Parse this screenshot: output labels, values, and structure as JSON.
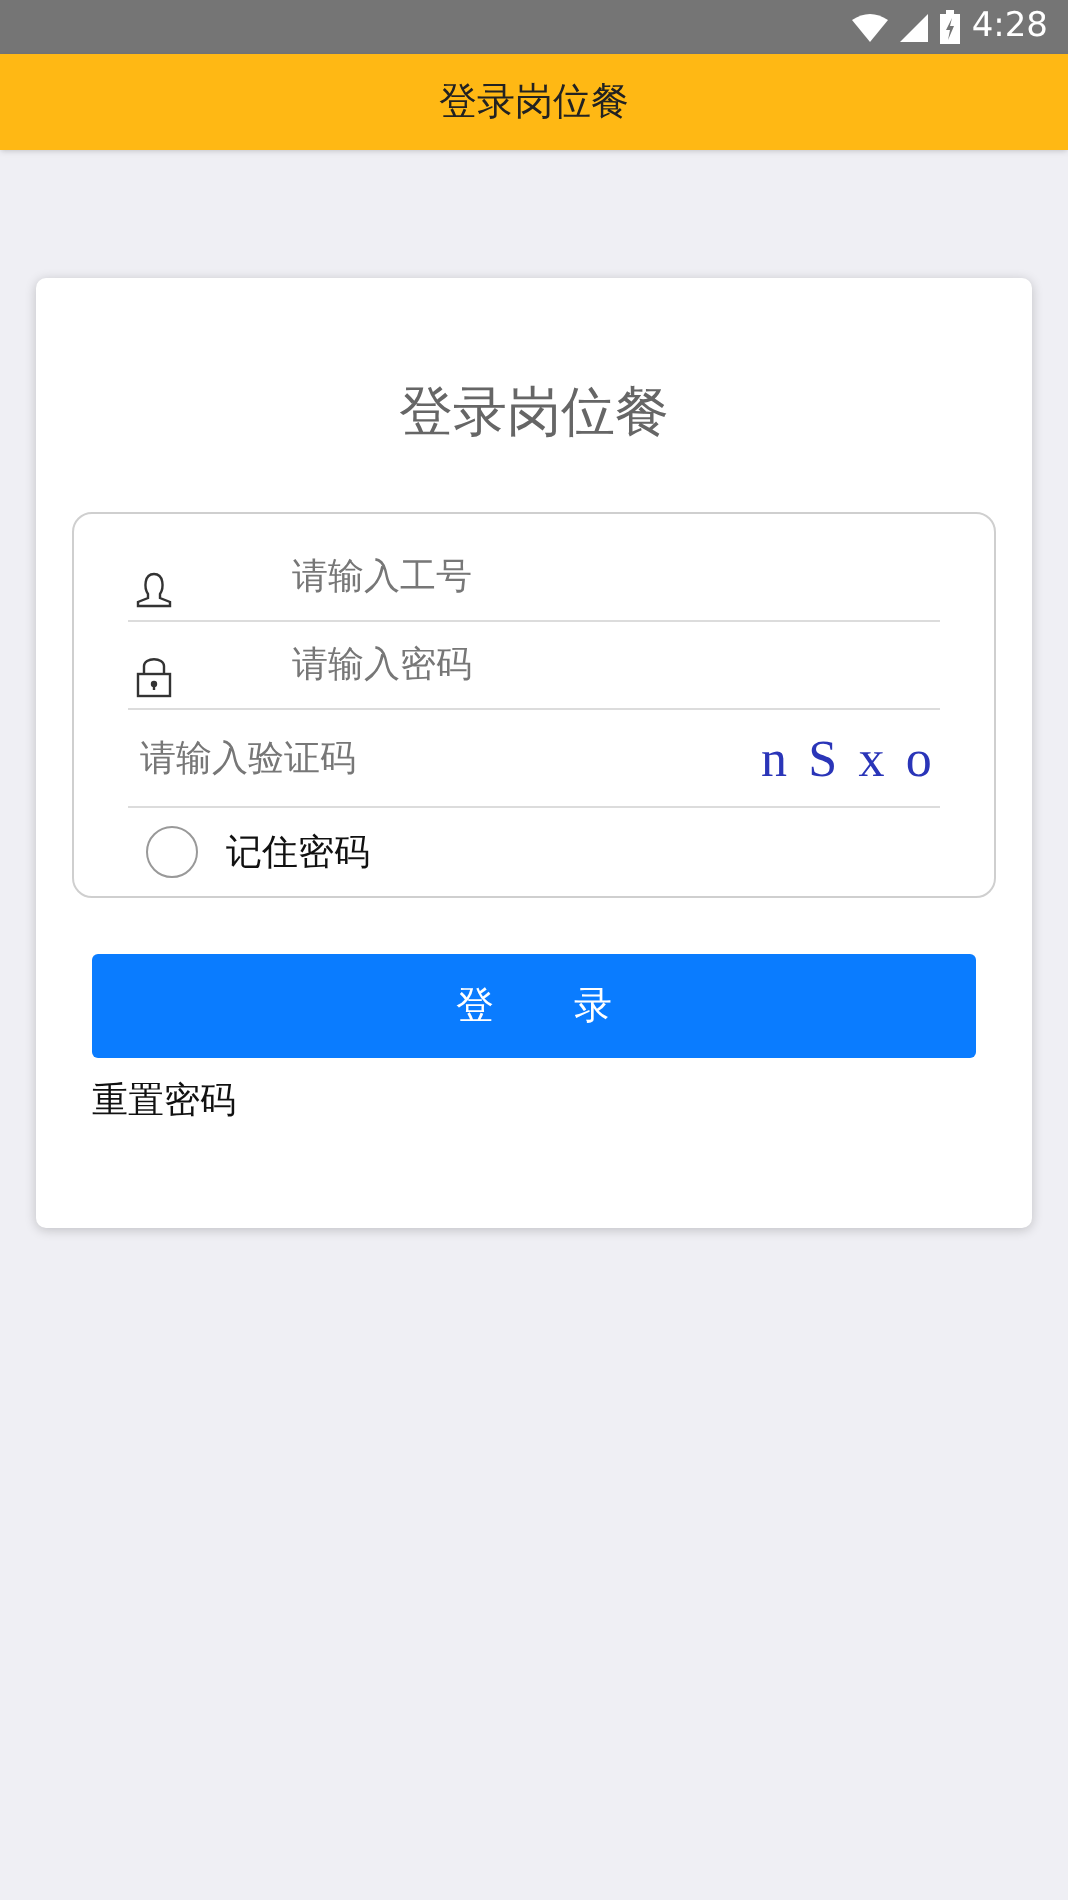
{
  "status_bar": {
    "time": "4:28"
  },
  "header": {
    "title": "登录岗位餐"
  },
  "form": {
    "title": "登录岗位餐",
    "fields": [
      {
        "kind": "user",
        "placeholder": "请输入工号"
      },
      {
        "kind": "password",
        "placeholder": "请输入密码"
      },
      {
        "kind": "captcha",
        "placeholder": "请输入验证码",
        "captcha": "n S x o"
      }
    ],
    "remember": {
      "label": "记住密码",
      "checked": false
    },
    "login_button": "登 录",
    "reset_link": "重置密码"
  }
}
